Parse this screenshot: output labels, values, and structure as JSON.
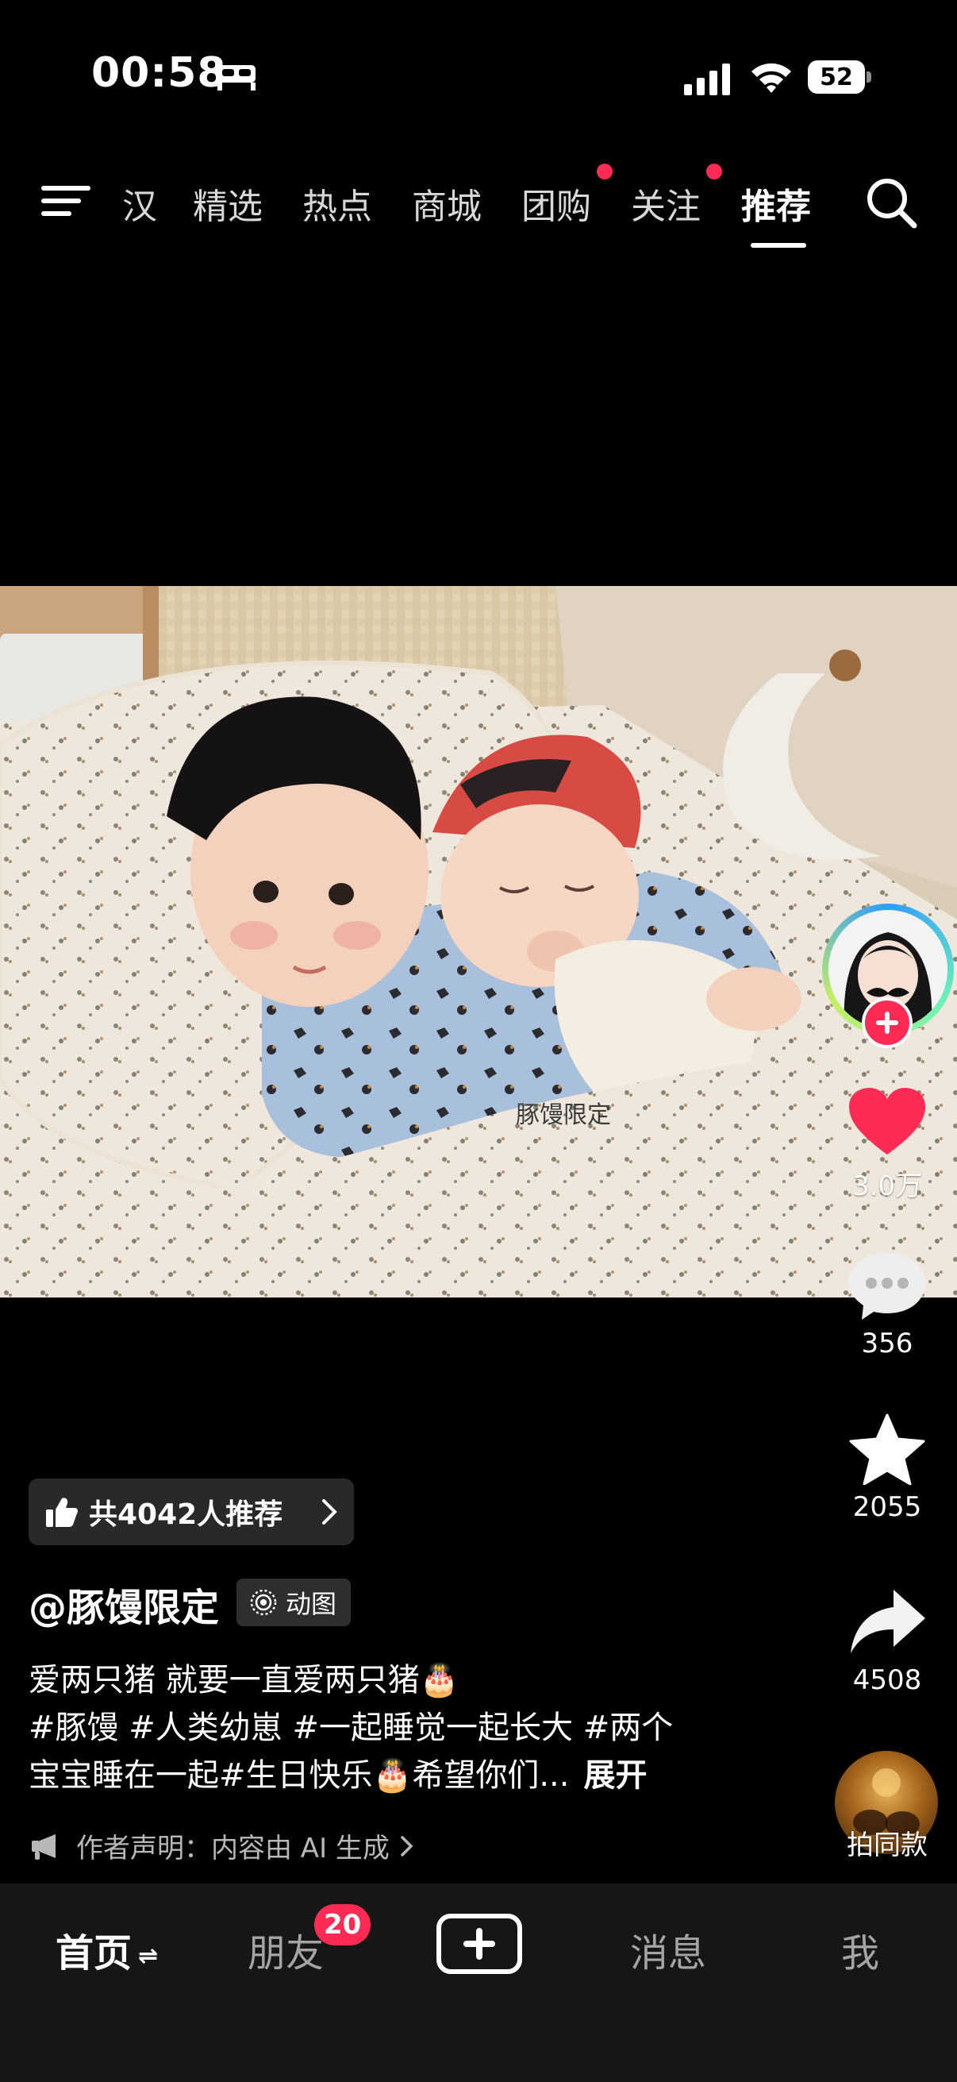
{
  "status_bar": {
    "time": "00:58",
    "battery": "52",
    "icons": [
      "bed-icon",
      "signal-icon",
      "wifi-icon",
      "battery-icon"
    ]
  },
  "top_nav": {
    "tabs": [
      {
        "label": "汉",
        "badge": false
      },
      {
        "label": "精选",
        "badge": false
      },
      {
        "label": "热点",
        "badge": false
      },
      {
        "label": "商城",
        "badge": false
      },
      {
        "label": "团购",
        "badge": true
      },
      {
        "label": "关注",
        "badge": true
      },
      {
        "label": "推荐",
        "badge": false,
        "active": true
      }
    ],
    "menu_icon": "menu-icon",
    "search_icon": "search-icon"
  },
  "video": {
    "watermark": "豚馒限定"
  },
  "actions": {
    "likes": "3.0万",
    "comments": "356",
    "favorites": "2055",
    "shares": "4508",
    "same_style": "拍同款"
  },
  "info": {
    "recommend": "共4042人推荐",
    "author": "@豚馒限定",
    "badge": "动图",
    "caption_lines": [
      "爱两只猪 就要一直爱两只猪🎂",
      "#豚馒 #人类幼崽 #一起睡觉一起长大 #两个",
      "宝宝睡在一起#生日快乐🎂希望你们..."
    ],
    "expand": "展开",
    "declaration": "作者声明：内容由 AI 生成"
  },
  "bottom_nav": {
    "home": "首页",
    "friends": "朋友",
    "friends_badge": "20",
    "messages": "消息",
    "me": "我"
  },
  "colors": {
    "accent": "#fe2c55",
    "background": "#000000",
    "bottom_bar": "#161616"
  }
}
